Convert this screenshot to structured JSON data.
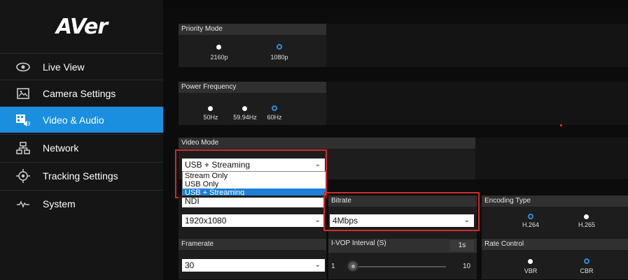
{
  "logo": "AVer",
  "nav": [
    {
      "label": "Live View",
      "icon": "eye-icon"
    },
    {
      "label": "Camera Settings",
      "icon": "image-icon"
    },
    {
      "label": "Video & Audio",
      "icon": "video-audio-icon",
      "active": true
    },
    {
      "label": "Network",
      "icon": "network-icon"
    },
    {
      "label": "Tracking Settings",
      "icon": "tracking-icon"
    },
    {
      "label": "System",
      "icon": "waveform-icon"
    }
  ],
  "priority_mode": {
    "title": "Priority Mode",
    "options": [
      "2160p",
      "1080p"
    ],
    "selected": "1080p"
  },
  "power_frequency": {
    "title": "Power Frequency",
    "options": [
      "50Hz",
      "59.94Hz",
      "60Hz"
    ],
    "selected": "60Hz"
  },
  "video_mode": {
    "title": "Video Mode",
    "value": "USB + Streaming",
    "options": [
      "Stream Only",
      "USB Only",
      "USB + Streaming"
    ],
    "selected": "USB + Streaming"
  },
  "stream_format": {
    "value": "NDI"
  },
  "resolution": {
    "value": "1920x1080"
  },
  "bitrate": {
    "title": "Bitrate",
    "value": "4Mbps"
  },
  "encoding_type": {
    "title": "Encoding Type",
    "options": [
      "H.264",
      "H.265"
    ],
    "selected": "H.264"
  },
  "framerate": {
    "title": "Framerate",
    "value": "30"
  },
  "ivop": {
    "title": "I-VOP Interval (S)",
    "value_label": "1s",
    "min": "1",
    "max": "10",
    "value": 1
  },
  "rate_control": {
    "title": "Rate Control",
    "options": [
      "VBR",
      "CBR"
    ],
    "selected": "CBR"
  },
  "colors": {
    "accent": "#1a8fe0",
    "highlight": "#d42a2a",
    "radio_selected": "#2d8de0"
  }
}
